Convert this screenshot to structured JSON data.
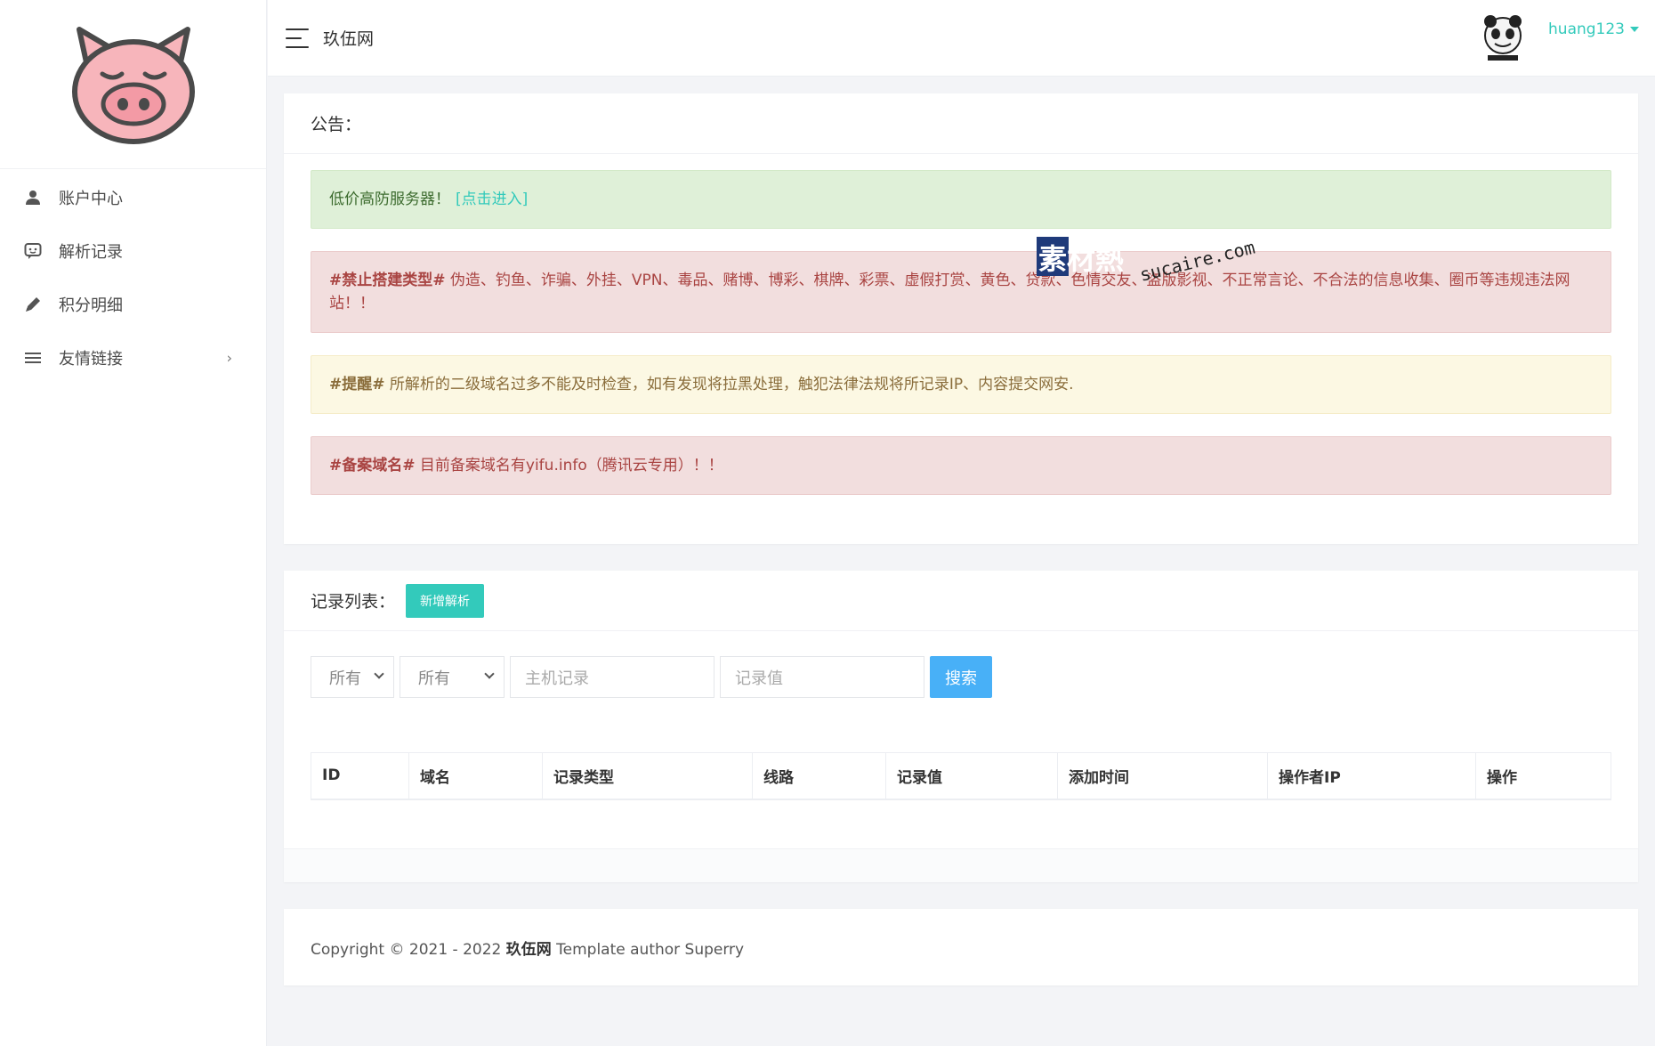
{
  "header": {
    "site_title": "玖伍网",
    "username": "huang123"
  },
  "sidebar": {
    "items": [
      {
        "label": "账户中心",
        "icon": "user-icon"
      },
      {
        "label": "解析记录",
        "icon": "chat-icon"
      },
      {
        "label": "积分明细",
        "icon": "pencil-icon"
      },
      {
        "label": "友情链接",
        "icon": "menu-icon"
      }
    ]
  },
  "notice": {
    "title": "公告：",
    "alerts": {
      "promo_text": "低价高防服务器！",
      "promo_link": "[点击进入]",
      "ban_tag": "#禁止搭建类型#",
      "ban_text": " 伪造、钓鱼、诈骗、外挂、VPN、毒品、赌博、博彩、棋牌、彩票、虚假打赏、黄色、贷款、色情交友、盗版影视、不正常言论、不合法的信息收集、圈币等违规违法网站！！",
      "remind_tag": "#提醒#",
      "remind_text": " 所解析的二级域名过多不能及时检查，如有发现将拉黑处理，触犯法律法规将所记录IP、内容提交网安.",
      "record_tag": "#备案域名#",
      "record_text": " 目前备案域名有yifu.info（腾讯云专用）！！"
    }
  },
  "records": {
    "title": "记录列表：",
    "new_button": "新增解析",
    "filter_type": "所有",
    "filter_line": "所有",
    "host_placeholder": "主机记录",
    "value_placeholder": "记录值",
    "search_button": "搜索",
    "columns": [
      "ID",
      "域名",
      "记录类型",
      "线路",
      "记录值",
      "添加时间",
      "操作者IP",
      "操作"
    ]
  },
  "footer": {
    "prefix": "Copyright © 2021 - 2022 ",
    "site": "玖伍网",
    "suffix": " Template author Superry"
  },
  "watermark": {
    "brand": "素材熱",
    "domain": "sucaire.com"
  },
  "colors": {
    "accent": "#33cabb",
    "search": "#48b0f7"
  }
}
